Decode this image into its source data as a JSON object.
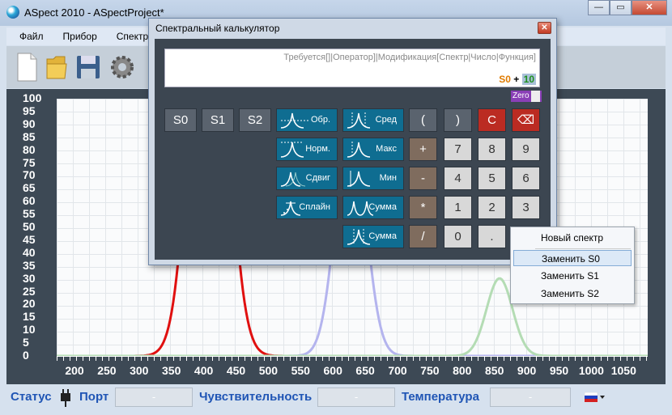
{
  "window": {
    "title": "ASpect 2010 - ASpectProject*"
  },
  "menu": [
    "Файл",
    "Прибор",
    "Спектр"
  ],
  "plot": {
    "y_ticks": [
      "100",
      "95",
      "90",
      "85",
      "80",
      "75",
      "70",
      "65",
      "60",
      "55",
      "50",
      "45",
      "40",
      "35",
      "30",
      "25",
      "20",
      "15",
      "10",
      "5",
      "0"
    ],
    "x_ticks": [
      "200",
      "250",
      "300",
      "350",
      "400",
      "450",
      "500",
      "550",
      "600",
      "650",
      "700",
      "750",
      "800",
      "850",
      "900",
      "950",
      "1000",
      "1050"
    ]
  },
  "status": {
    "status_label": "Статус",
    "port_label": "Порт",
    "port_value": "-",
    "sensitivity_label": "Чувствительность",
    "sensitivity_value": "-",
    "temperature_label": "Температура",
    "temperature_value": "-"
  },
  "dialog": {
    "title": "Спектральный калькулятор",
    "close": "✕",
    "hint": "Требуется[]|Оператор]|Модификация[Спектр|Число|Функция]",
    "expr_s0": "S0",
    "expr_plus": " + ",
    "expr_num": "10",
    "zero_label": "Zero",
    "s_buttons": [
      "S0",
      "S1",
      "S2"
    ],
    "fn_buttons": {
      "obr": "Обр.",
      "norm": "Норм.",
      "sdvig": "Сдвиг",
      "spline": "Сплайн",
      "sred": "Сред",
      "maks": "Макс",
      "min": "Мин",
      "summa1": "Сумма",
      "summa2": "Сумма"
    },
    "keys": {
      "lparen": "(",
      "rparen": ")",
      "clear": "C",
      "back": "⌫",
      "plus": "+",
      "minus": "-",
      "mul": "*",
      "div": "/",
      "k7": "7",
      "k8": "8",
      "k9": "9",
      "k4": "4",
      "k5": "5",
      "k6": "6",
      "k1": "1",
      "k2": "2",
      "k3": "3",
      "k0": "0",
      "dot": "."
    }
  },
  "context_menu": {
    "items": [
      "Новый спектр",
      "Заменить S0",
      "Заменить S1",
      "Заменить S2"
    ],
    "selected": 1
  },
  "colors": {
    "red_curve": "#e01010",
    "blue_curve": "#b4b4ee",
    "green_curve": "#b4dcb4"
  }
}
